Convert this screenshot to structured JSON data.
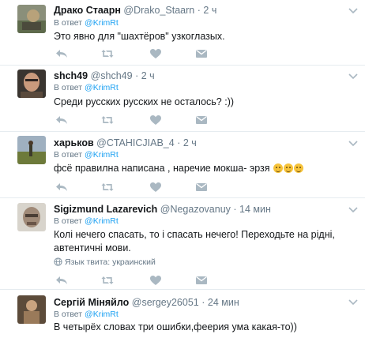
{
  "tweets": [
    {
      "name": "Драко Стаарн",
      "handle": "@Drako_Staarn",
      "time": "2 ч",
      "reply_prefix": "В ответ",
      "reply_handle": "@KrimRt",
      "text": "Это явно для \"шахтёров\" узкоглазых.",
      "emojis": 0,
      "lang_label": ""
    },
    {
      "name": "shch49",
      "handle": "@shch49",
      "time": "2 ч",
      "reply_prefix": "В ответ",
      "reply_handle": "@KrimRt",
      "text": "Среди русских русских не осталось? :))",
      "emojis": 0,
      "lang_label": ""
    },
    {
      "name": "харьков",
      "handle": "@CTAHICJIAB_4",
      "time": "2 ч",
      "reply_prefix": "В ответ",
      "reply_handle": "@KrimRt",
      "text": "фсё правилна написана , наречие мокша- эрзя",
      "emojis": 3,
      "lang_label": ""
    },
    {
      "name": "Sigizmund Lazarevich",
      "handle": "@Negazovanuy",
      "time": "14 мин",
      "reply_prefix": "В ответ",
      "reply_handle": "@KrimRt",
      "text": "Колі нечего спасать, то і спасать нечего! Переходьте на рідні, автентичні мови.",
      "emojis": 0,
      "lang_label": "Язык твита: украинский"
    },
    {
      "name": "Сергій Міняйло",
      "handle": "@sergey26051",
      "time": "24 мин",
      "reply_prefix": "В ответ",
      "reply_handle": "@KrimRt",
      "text": "В четырёх словах три ошибки,феерия ума какая-то))",
      "emojis": 0,
      "lang_label": ""
    }
  ],
  "separator": "·",
  "colors": {
    "name": "#14171a",
    "meta": "#657786",
    "link": "#1da1f2",
    "icon": "#aab8c2",
    "divider": "#e6ecf0"
  },
  "icons": [
    "reply-icon",
    "retweet-icon",
    "like-icon",
    "direct-message-icon",
    "chevron-down-icon",
    "globe-icon"
  ]
}
